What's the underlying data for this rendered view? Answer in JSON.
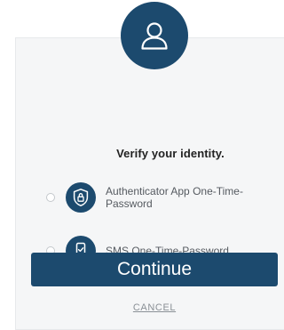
{
  "heading": {
    "title": "Verify your identity."
  },
  "options": [
    {
      "label": "Authenticator App One-Time-Password",
      "icon": "lock-shield-icon",
      "selected": false
    },
    {
      "label": "SMS One-Time-Password",
      "icon": "phone-check-icon",
      "selected": false
    }
  ],
  "actions": {
    "continue_label": "Continue",
    "cancel_label": "CANCEL"
  },
  "icons": {
    "avatar": "user-icon"
  },
  "colors": {
    "primary": "#1c4a6e",
    "card_background": "#f5f6f7",
    "text": "#222222",
    "muted_text": "#555a60",
    "link": "#8a9096"
  }
}
